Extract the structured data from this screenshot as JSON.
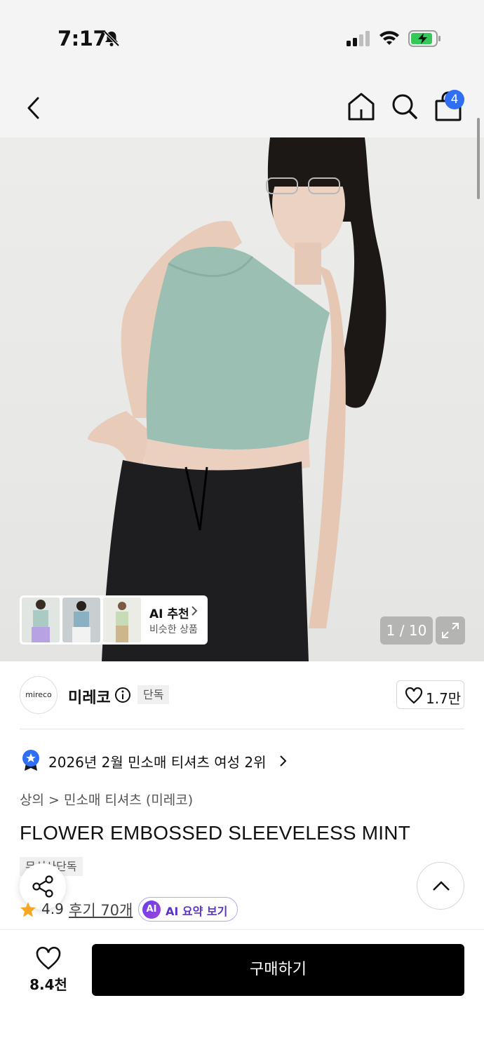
{
  "status_bar": {
    "time": "7:17"
  },
  "nav": {
    "cart_count": "4"
  },
  "hero": {
    "image_counter": "1 / 10",
    "ai_recommend": {
      "title": "AI 추천",
      "subtitle": "비슷한 상품"
    }
  },
  "brand": {
    "logo_text": "mireco",
    "name": "미레코",
    "exclusive_tag": "단독",
    "like_count": "1.7만"
  },
  "ranking": {
    "text": "2026년 2월 민소매 티셔츠 여성 2위"
  },
  "breadcrumb": {
    "text": "상의 > 민소매 티셔츠 (미레코)"
  },
  "product": {
    "title": "FLOWER EMBOSSED SLEEVELESS MINT",
    "tag": "무신사단독",
    "rating": "4.9",
    "review_link": "후기 70개",
    "ai_badge": "AI",
    "ai_summary": "AI 요약 보기"
  },
  "bottom_bar": {
    "wish_count": "8.4천",
    "buy_label": "구매하기"
  },
  "colors": {
    "accent_blue": "#2f6ff5",
    "ai_purple": "#5a33c7",
    "star": "#f5a623",
    "buy_button": "#000000"
  }
}
